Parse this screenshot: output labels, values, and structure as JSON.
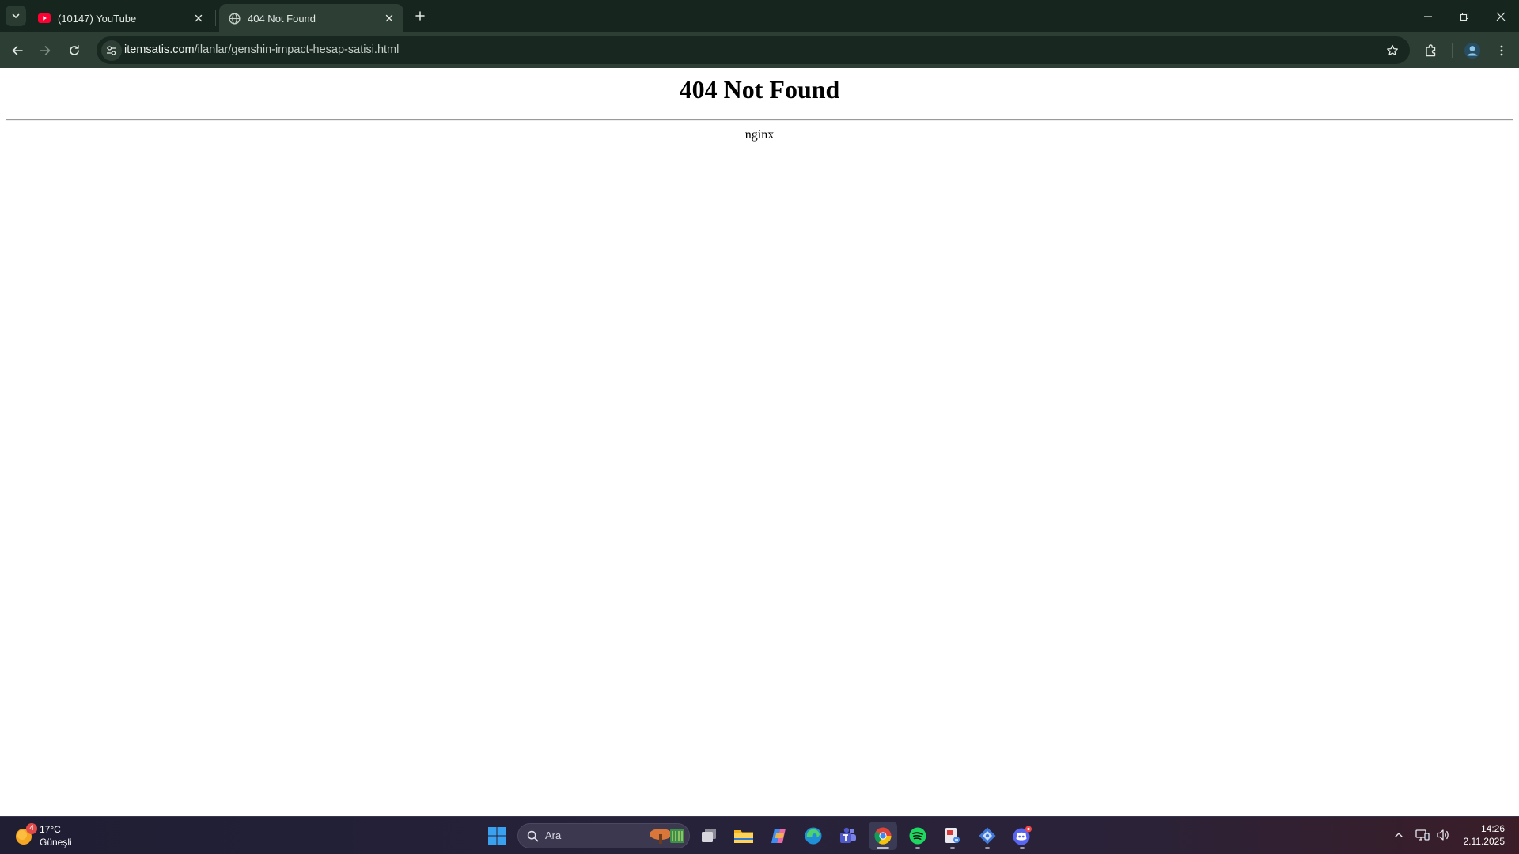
{
  "browser": {
    "tabs": [
      {
        "title": "(10147) YouTube",
        "favicon": "youtube-icon",
        "active": false
      },
      {
        "title": "404 Not Found",
        "favicon": "globe-icon",
        "active": true
      }
    ],
    "url_host": "itemsatis.com",
    "url_path": "/ilanlar/genshin-impact-hesap-satisi.html"
  },
  "page": {
    "heading": "404 Not Found",
    "server": "nginx"
  },
  "taskbar": {
    "weather": {
      "temperature": "17°C",
      "condition": "Güneşli",
      "badge": "4"
    },
    "search_placeholder": "Ara",
    "apps": [
      "windows-start-icon",
      "task-view-icon",
      "file-explorer-icon",
      "copilot-icon",
      "edge-icon",
      "teams-icon",
      "chrome-icon",
      "spotify-icon",
      "snipping-tool-icon",
      "app-icon",
      "discord-icon"
    ],
    "clock": {
      "time": "14:26",
      "date": "2.11.2025"
    }
  },
  "colors": {
    "tabstrip": "#16261e",
    "toolbar": "#2d3e35",
    "omnibox": "#182821",
    "taskbar": "#26223a"
  }
}
